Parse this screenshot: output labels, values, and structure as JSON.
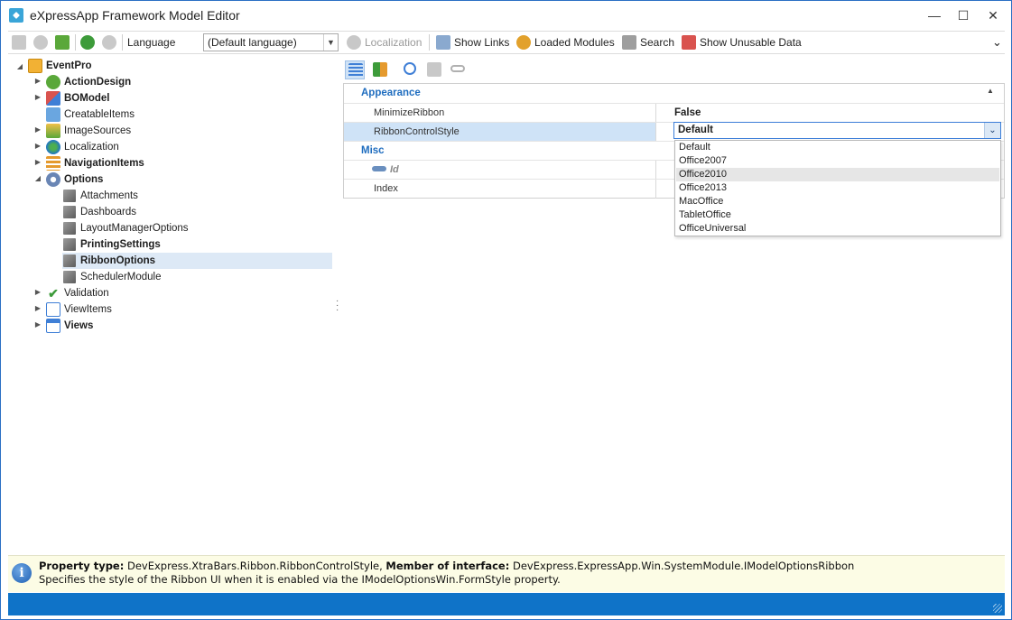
{
  "window": {
    "title": "eXpressApp Framework Model Editor",
    "minimize_glyph": "—",
    "maximize_glyph": "☐",
    "close_glyph": "✕"
  },
  "toolbar": {
    "language_label": "Language",
    "language_value": "(Default language)",
    "localization_label": "Localization",
    "show_links_label": "Show Links",
    "loaded_modules_label": "Loaded Modules",
    "search_label": "Search",
    "show_unusable_label": "Show Unusable Data",
    "overflow_glyph": "⌄"
  },
  "tree": {
    "root": "EventPro",
    "items": [
      {
        "label": "ActionDesign"
      },
      {
        "label": "BOModel"
      },
      {
        "label": "CreatableItems"
      },
      {
        "label": "ImageSources"
      },
      {
        "label": "Localization"
      },
      {
        "label": "NavigationItems"
      },
      {
        "label": "Options"
      },
      {
        "label": "Attachments"
      },
      {
        "label": "Dashboards"
      },
      {
        "label": "LayoutManagerOptions"
      },
      {
        "label": "PrintingSettings"
      },
      {
        "label": "RibbonOptions"
      },
      {
        "label": "SchedulerModule"
      },
      {
        "label": "Validation"
      },
      {
        "label": "ViewItems"
      },
      {
        "label": "Views"
      }
    ]
  },
  "grid": {
    "categories": [
      {
        "label": "Appearance"
      },
      {
        "label": "Misc"
      }
    ],
    "rows": [
      {
        "name": "MinimizeRibbon",
        "value": "False"
      },
      {
        "name": "RibbonControlStyle",
        "value": "Default"
      },
      {
        "name": "Id",
        "value": ""
      },
      {
        "name": "Index",
        "value": ""
      }
    ],
    "options": [
      "Default",
      "Office2007",
      "Office2010",
      "Office2013",
      "MacOffice",
      "TabletOffice",
      "OfficeUniversal"
    ]
  },
  "info": {
    "type_label": "Property type:",
    "type_value": " DevExpress.XtraBars.Ribbon.RibbonControlStyle, ",
    "member_label": "Member of interface:",
    "member_value": " DevExpress.ExpressApp.Win.SystemModule.IModelOptionsRibbon",
    "description": "Specifies the style of the Ribbon UI when it is enabled via the IModelOptionsWin.FormStyle property."
  },
  "colors": {
    "accent": "#0f73c8",
    "category_text": "#1f6dbf",
    "selection": "#dde9f6"
  }
}
